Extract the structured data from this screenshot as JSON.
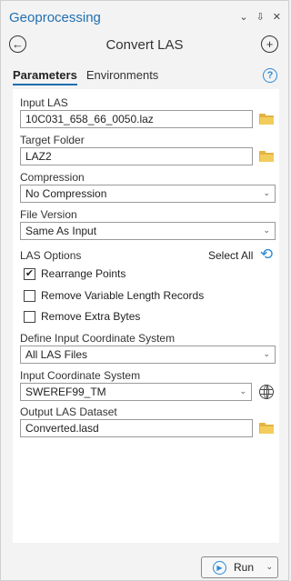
{
  "pane": {
    "title": "Geoprocessing",
    "controls": [
      "⌄",
      "⇩",
      "✕"
    ]
  },
  "nav": {
    "back_icon": "←",
    "tool_title": "Convert LAS",
    "add_icon": "+"
  },
  "tabs": [
    {
      "label": "Parameters",
      "active": true
    },
    {
      "label": "Environments",
      "active": false
    }
  ],
  "help": {
    "symbol": "?"
  },
  "params": {
    "input_las": {
      "label": "Input LAS",
      "value": "10C031_658_66_0050.laz"
    },
    "target_folder": {
      "label": "Target Folder",
      "value": "LAZ2"
    },
    "compression": {
      "label": "Compression",
      "value": "No Compression"
    },
    "file_version": {
      "label": "File Version",
      "value": "Same As Input"
    },
    "las_options": {
      "label": "LAS Options",
      "select_all": "Select All",
      "items": [
        {
          "label": "Rearrange Points",
          "checked": true
        },
        {
          "label": "Remove Variable Length Records",
          "checked": false
        },
        {
          "label": "Remove Extra Bytes",
          "checked": false
        }
      ]
    },
    "define_input_cs": {
      "label": "Define Input Coordinate System",
      "value": "All LAS Files"
    },
    "input_cs": {
      "label": "Input Coordinate System",
      "value": "SWEREF99_TM"
    },
    "output_dataset": {
      "label": "Output LAS Dataset",
      "value": "Converted.lasd"
    }
  },
  "run": {
    "label": "Run"
  },
  "colors": {
    "accent": "#1f6fb2",
    "icon_blue": "#2b8ad8",
    "folder": "#e3b341"
  }
}
